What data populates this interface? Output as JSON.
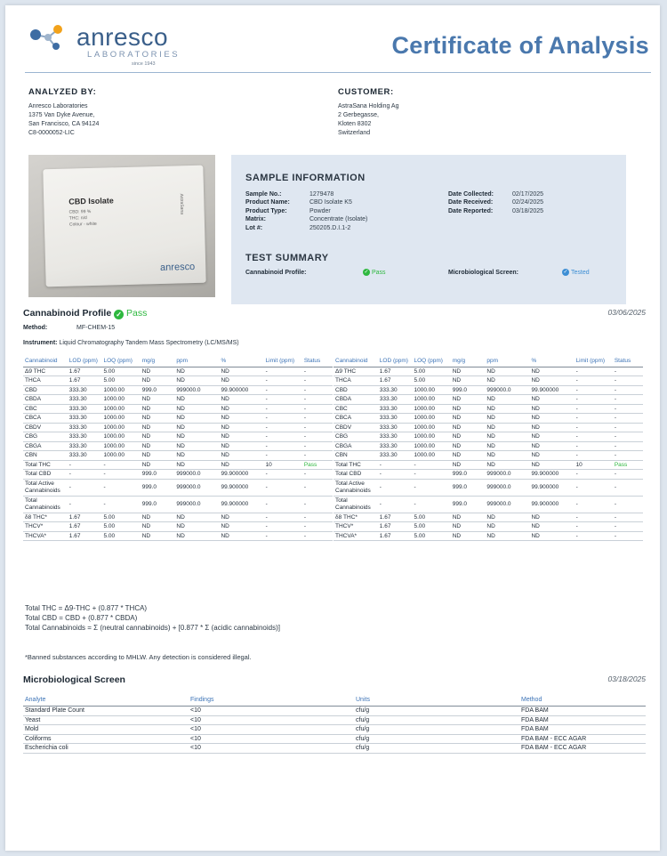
{
  "header": {
    "logo_word": "anresco",
    "logo_sub": "LABORATORIES",
    "logo_since": "since 1943",
    "title": "Certificate of Analysis"
  },
  "analyzed_by": {
    "heading": "ANALYZED BY:",
    "lines": [
      "Anresco Laboratories",
      "1375 Van Dyke Avenue,",
      "San Francisco, CA 94124",
      "C8-0000052-LIC"
    ]
  },
  "customer": {
    "heading": "CUSTOMER:",
    "lines": [
      "AstraSana Holding Ag",
      "2 Gerbegasse,",
      "Kloten 8302",
      "Switzerland"
    ]
  },
  "photo": {
    "bag_title": "CBD Isolate",
    "bag_lines": [
      "CBD: 99 %",
      "THC: n/d",
      "Colour - white"
    ],
    "bag_brand": "AstraSana",
    "bag_logo": "anresco"
  },
  "sample_info": {
    "heading": "SAMPLE INFORMATION",
    "left": [
      {
        "label": "Sample No.:",
        "value": "1279478"
      },
      {
        "label": "Product Name:",
        "value": "CBD Isolate K5"
      },
      {
        "label": "Product Type:",
        "value": "Powder"
      },
      {
        "label": "Matrix:",
        "value": "Concentrate (Isolate)"
      },
      {
        "label": "Lot #:",
        "value": "250205.D.I.1-2"
      }
    ],
    "right": [
      {
        "label": "Date Collected:",
        "value": "02/17/2025"
      },
      {
        "label": "Date Received:",
        "value": "02/24/2025"
      },
      {
        "label": "Date Reported:",
        "value": "03/18/2025"
      }
    ]
  },
  "test_summary": {
    "heading": "TEST SUMMARY",
    "cannabinoid_label": "Cannabinoid Profile:",
    "cannabinoid_result": "Pass",
    "micro_label": "Microbiological Screen:",
    "micro_result": "Tested"
  },
  "cannabinoid_profile": {
    "title": "Cannabinoid Profile",
    "status": "Pass",
    "date": "03/06/2025",
    "method_label": "Method:",
    "method": "MF-CHEM-15",
    "instrument_label": "Instrument:",
    "instrument": "Liquid Chromatography Tandem Mass Spectrometry (LC/MS/MS)",
    "columns": [
      "Cannabinoid",
      "LOD (ppm)",
      "LOQ (ppm)",
      "mg/g",
      "ppm",
      "%",
      "Limit (ppm)",
      "Status"
    ],
    "rows": [
      [
        "Δ9 THC",
        "1.67",
        "5.00",
        "ND",
        "ND",
        "ND",
        "-",
        "-"
      ],
      [
        "THCA",
        "1.67",
        "5.00",
        "ND",
        "ND",
        "ND",
        "-",
        "-"
      ],
      [
        "CBD",
        "333.30",
        "1000.00",
        "999.0",
        "999000.0",
        "99.900000",
        "-",
        "-"
      ],
      [
        "CBDA",
        "333.30",
        "1000.00",
        "ND",
        "ND",
        "ND",
        "-",
        "-"
      ],
      [
        "CBC",
        "333.30",
        "1000.00",
        "ND",
        "ND",
        "ND",
        "-",
        "-"
      ],
      [
        "CBCA",
        "333.30",
        "1000.00",
        "ND",
        "ND",
        "ND",
        "-",
        "-"
      ],
      [
        "CBDV",
        "333.30",
        "1000.00",
        "ND",
        "ND",
        "ND",
        "-",
        "-"
      ],
      [
        "CBG",
        "333.30",
        "1000.00",
        "ND",
        "ND",
        "ND",
        "-",
        "-"
      ],
      [
        "CBGA",
        "333.30",
        "1000.00",
        "ND",
        "ND",
        "ND",
        "-",
        "-"
      ],
      [
        "CBN",
        "333.30",
        "1000.00",
        "ND",
        "ND",
        "ND",
        "-",
        "-"
      ],
      [
        "Total THC",
        "-",
        "-",
        "ND",
        "ND",
        "ND",
        "10",
        "Pass"
      ],
      [
        "Total CBD",
        "-",
        "-",
        "999.0",
        "999000.0",
        "99.900000",
        "-",
        "-"
      ],
      [
        "Total Active Cannabinoids",
        "-",
        "-",
        "999.0",
        "999000.0",
        "99.900000",
        "-",
        "-"
      ],
      [
        "Total Cannabinoids",
        "-",
        "-",
        "999.0",
        "999000.0",
        "99.900000",
        "-",
        "-"
      ],
      [
        "δ8 THC*",
        "1.67",
        "5.00",
        "ND",
        "ND",
        "ND",
        "-",
        "-"
      ],
      [
        "THCV*",
        "1.67",
        "5.00",
        "ND",
        "ND",
        "ND",
        "-",
        "-"
      ],
      [
        "THCVA*",
        "1.67",
        "5.00",
        "ND",
        "ND",
        "ND",
        "-",
        "-"
      ]
    ]
  },
  "formulas": [
    "Total THC = Δ9-THC + (0.877 * THCA)",
    "Total CBD = CBD + (0.877 * CBDA)",
    "Total Cannabinoids = Σ (neutral cannabinoids) + [0.877 * Σ (acidic cannabinoids)]"
  ],
  "banned_note": "*Banned substances according to MHLW. Any detection is considered illegal.",
  "micro_screen": {
    "title": "Microbiological Screen",
    "date": "03/18/2025",
    "columns": [
      "Analyte",
      "Findings",
      "Units",
      "Method"
    ],
    "rows": [
      [
        "Standard Plate Count",
        "<10",
        "cfu/g",
        "FDA BAM"
      ],
      [
        "Yeast",
        "<10",
        "cfu/g",
        "FDA BAM"
      ],
      [
        "Mold",
        "<10",
        "cfu/g",
        "FDA BAM"
      ],
      [
        "Coliforms",
        "<10",
        "cfu/g",
        "FDA BAM - ECC AGAR"
      ],
      [
        "Escherichia coli",
        "<10",
        "cfu/g",
        "FDA BAM - ECC AGAR"
      ]
    ]
  },
  "colors": {
    "brand_blue": "#4a78ad",
    "header_blue": "#3c73b6",
    "pass_green": "#2eb83f",
    "tested_blue": "#3c8ed4",
    "panel_bg": "#dfe7f1"
  }
}
